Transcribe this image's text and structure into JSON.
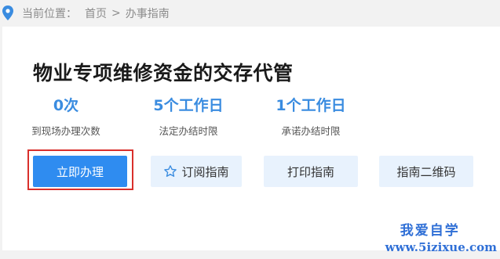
{
  "breadcrumb": {
    "prefix": "当前位置：",
    "home": "首页",
    "separator": ">",
    "current": "办事指南"
  },
  "card": {
    "title": "物业专项维修资金的交存代管",
    "stats": [
      {
        "value": "0次",
        "label": "到现场办理次数"
      },
      {
        "value": "5个工作日",
        "label": "法定办结时限"
      },
      {
        "value": "1个工作日",
        "label": "承诺办结时限"
      }
    ],
    "buttons": {
      "apply": "立即办理",
      "subscribe": "订阅指南",
      "print": "打印指南",
      "qrcode": "指南二维码"
    }
  },
  "watermark": {
    "name": "我爱自学",
    "url": "www.5izixue.com"
  },
  "colors": {
    "accent": "#2f8cf0",
    "stat_value": "#3a8ce0",
    "highlight_border": "#d9302c",
    "watermark": "#2f6fd6"
  }
}
